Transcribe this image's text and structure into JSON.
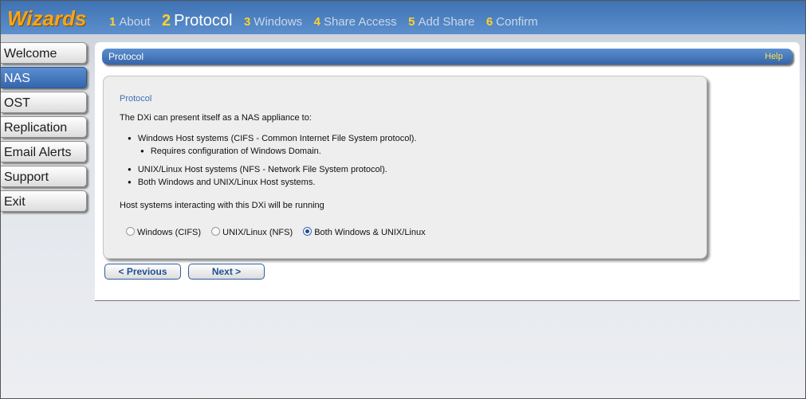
{
  "app": {
    "logo": "Wizards"
  },
  "steps": [
    {
      "num": "1",
      "label": "About"
    },
    {
      "num": "2",
      "label": "Protocol"
    },
    {
      "num": "3",
      "label": "Windows"
    },
    {
      "num": "4",
      "label": "Share Access"
    },
    {
      "num": "5",
      "label": "Add Share"
    },
    {
      "num": "6",
      "label": "Confirm"
    }
  ],
  "sidebar": {
    "items": [
      {
        "label": "Welcome"
      },
      {
        "label": "NAS"
      },
      {
        "label": "OST"
      },
      {
        "label": "Replication"
      },
      {
        "label": "Email Alerts"
      },
      {
        "label": "Support"
      },
      {
        "label": "Exit"
      }
    ],
    "active": "NAS"
  },
  "content": {
    "title": "Protocol",
    "help": "Help",
    "panel_title": "Protocol",
    "intro": "The DXi can present itself as a NAS appliance to:",
    "bullets": [
      "Windows Host systems (CIFS - Common Internet File System protocol).",
      "Requires configuration of Windows Domain.",
      "UNIX/Linux Host systems (NFS - Network File System protocol).",
      "Both Windows and UNIX/Linux Host systems."
    ],
    "question": "Host systems interacting with this DXi will be running",
    "options": [
      {
        "label": "Windows (CIFS)",
        "selected": false
      },
      {
        "label": "UNIX/Linux (NFS)",
        "selected": false
      },
      {
        "label": "Both Windows & UNIX/Linux",
        "selected": true
      }
    ]
  },
  "buttons": {
    "previous": "< Previous",
    "next": "Next >"
  }
}
